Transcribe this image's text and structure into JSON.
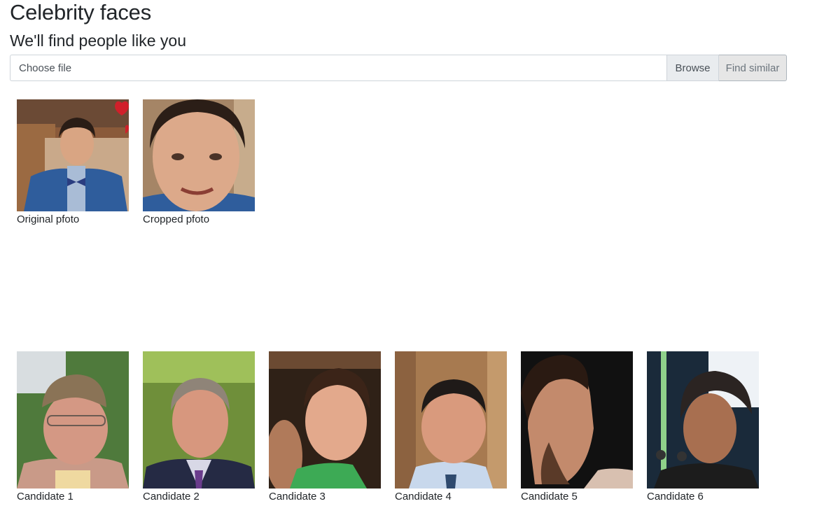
{
  "header": {
    "title": "Celebrity faces",
    "subtitle": "We'll find people like you"
  },
  "upload": {
    "file_placeholder": "Choose file",
    "browse_label": "Browse",
    "find_label": "Find similar"
  },
  "uploaded": [
    {
      "caption": "Original pfoto"
    },
    {
      "caption": "Cropped pfoto"
    }
  ],
  "candidates": [
    {
      "caption": "Candidate 1"
    },
    {
      "caption": "Candidate 2"
    },
    {
      "caption": "Candidate 3"
    },
    {
      "caption": "Candidate 4"
    },
    {
      "caption": "Candidate 5"
    },
    {
      "caption": "Candidate 6"
    }
  ],
  "colors": {
    "input_border": "#ced4da",
    "browse_bg": "#e9ecef",
    "find_bg": "#e6e6e6",
    "text": "#212529"
  }
}
